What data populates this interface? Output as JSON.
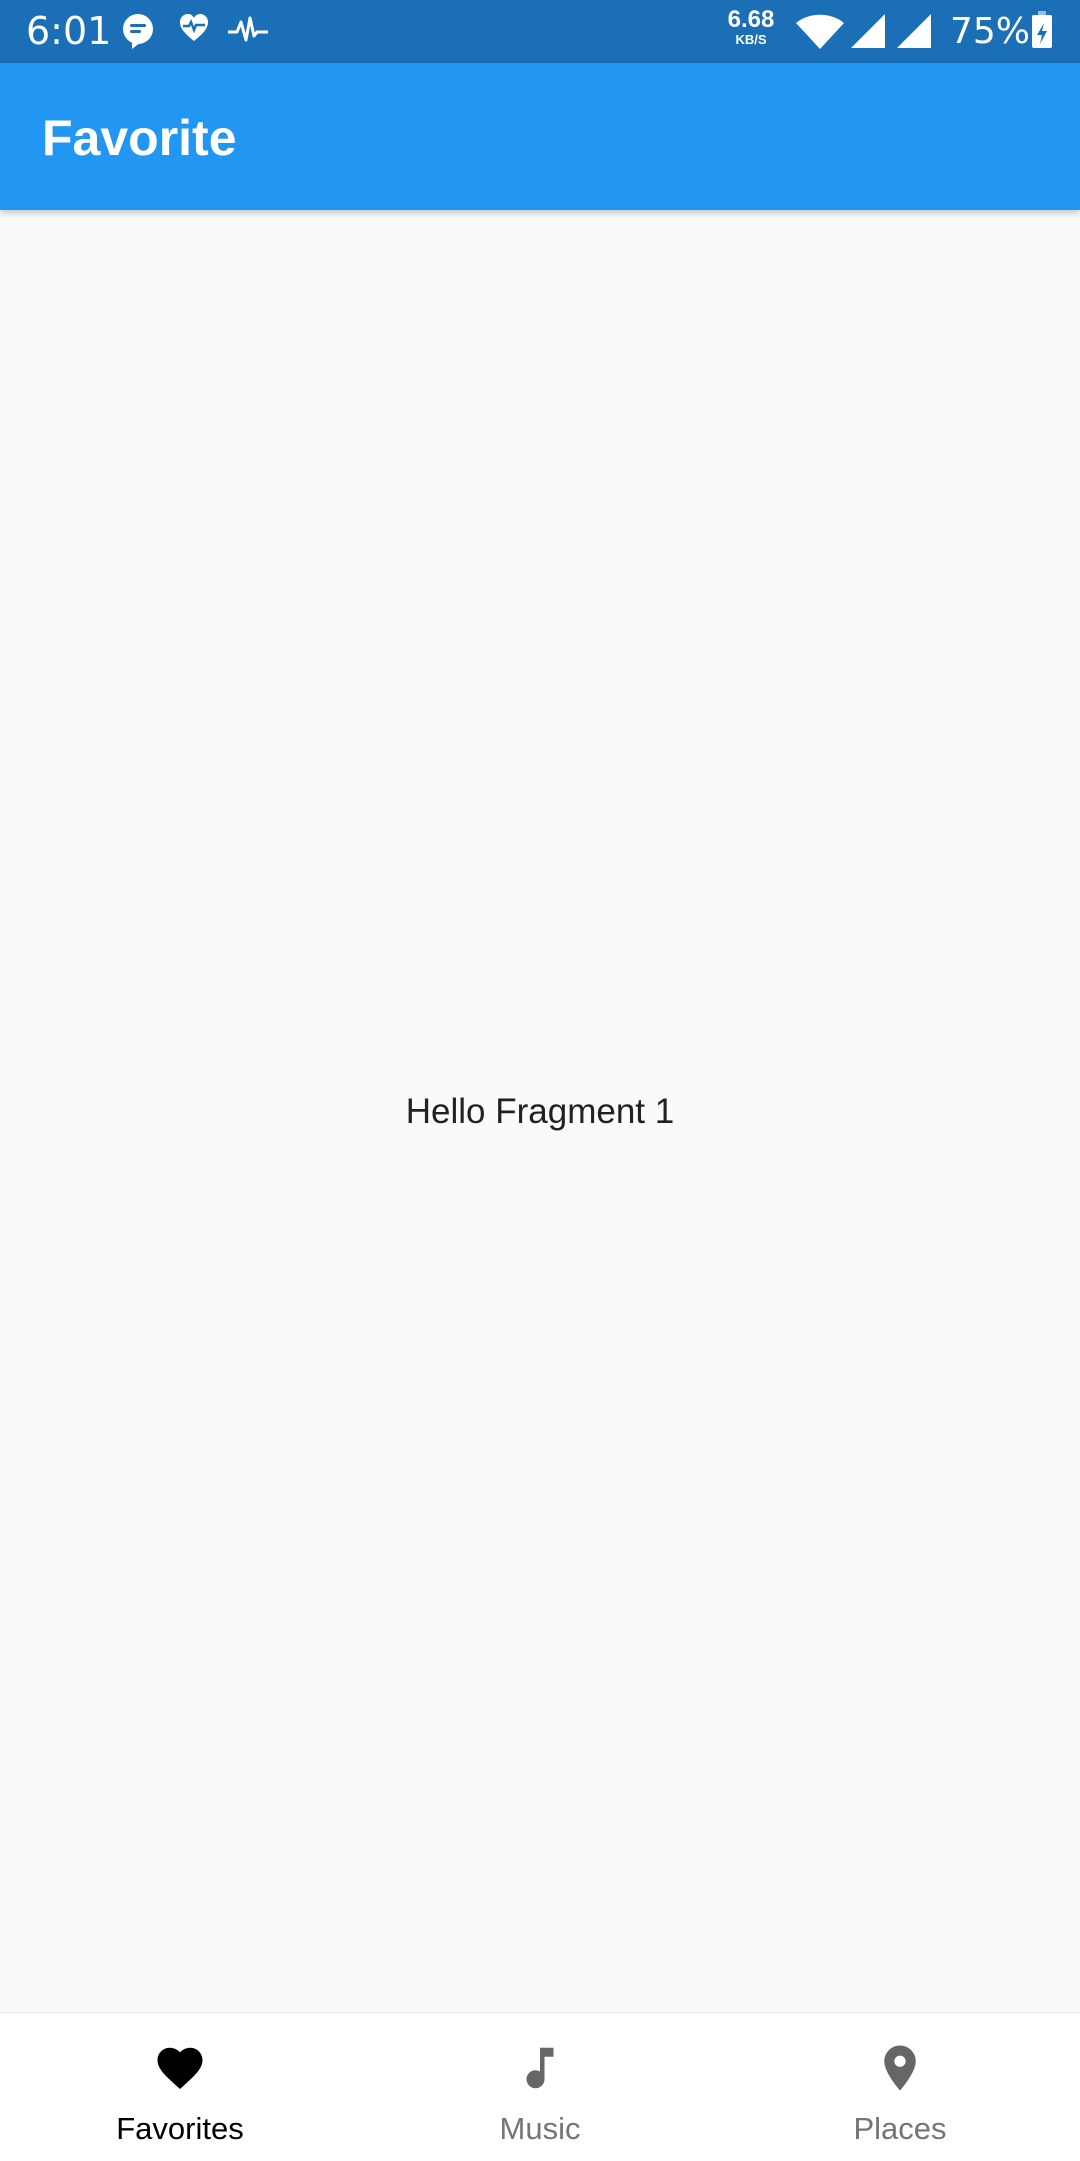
{
  "status_bar": {
    "time": "6:01",
    "net_speed_value": "6.68",
    "net_speed_unit": "KB/S",
    "battery_percent": "75%",
    "icons": [
      "chat-bubble-icon",
      "heart-rate-icon",
      "pulse-icon",
      "wifi-icon",
      "signal-icon",
      "signal-icon-2",
      "battery-charging-icon"
    ]
  },
  "app_bar": {
    "title": "Favorite",
    "color": "#2196f3"
  },
  "content": {
    "message": "Hello Fragment 1"
  },
  "bottom_nav": {
    "items": [
      {
        "label": "Favorites",
        "icon": "heart-icon",
        "selected": true,
        "color": "#000000"
      },
      {
        "label": "Music",
        "icon": "music-note-icon",
        "selected": false,
        "color": "#757575"
      },
      {
        "label": "Places",
        "icon": "place-icon",
        "selected": false,
        "color": "#757575"
      }
    ]
  }
}
